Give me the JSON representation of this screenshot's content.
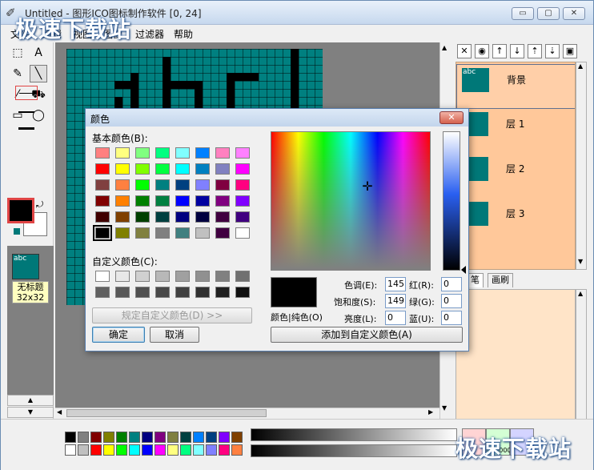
{
  "window": {
    "title": "Untitled - 图形ICO图标制作软件 [0, 24]",
    "watermark": "极速下载站",
    "controls": {
      "minimize": "▭",
      "maximize": "▢",
      "close": "✕"
    }
  },
  "menu": [
    "文件",
    "编辑",
    "视图",
    "图像",
    "过滤器",
    "帮助"
  ],
  "tools": {
    "select": "⬚",
    "text": "A",
    "pencil": "✎",
    "line": "╲",
    "eyedropper": "⁄",
    "fill": "⛟",
    "rect": "▭",
    "ellipse": "◯"
  },
  "thumbnail": {
    "abc": "abc",
    "name": "无标题",
    "size": "32x32"
  },
  "layers": {
    "items": [
      {
        "name": "背景",
        "abc": "abc"
      },
      {
        "name": "层 1",
        "abc": ""
      },
      {
        "name": "层 2",
        "abc": ""
      },
      {
        "name": "层 3",
        "abc": ""
      }
    ],
    "toolbar": [
      "✕",
      "◉",
      "↑",
      "↓",
      "⇡",
      "⇣",
      "▣"
    ],
    "tabs": [
      "笔",
      "画刷"
    ]
  },
  "dialog": {
    "title": "颜色",
    "close": "✕",
    "basic_label": "基本颜色(B):",
    "custom_label": "自定义颜色(C):",
    "define_button": "规定自定义颜色(D) >>",
    "ok_button": "确定",
    "cancel_button": "取消",
    "add_button": "添加到自定义颜色(A)",
    "color_solid_label": "颜色|纯色(O)",
    "fields": {
      "hue_label": "色调(E):",
      "hue": "145",
      "sat_label": "饱和度(S):",
      "sat": "149",
      "lum_label": "亮度(L):",
      "lum": "0",
      "red_label": "红(R):",
      "red": "0",
      "green_label": "绿(G):",
      "green": "0",
      "blue_label": "蓝(U):",
      "blue": "0"
    },
    "basic_colors": [
      [
        "#ff8080",
        "#ffff80",
        "#80ff80",
        "#00ff80",
        "#80ffff",
        "#0080ff",
        "#ff80c0",
        "#ff80ff"
      ],
      [
        "#ff0000",
        "#ffff00",
        "#80ff00",
        "#00ff40",
        "#00ffff",
        "#0080c0",
        "#8080c0",
        "#ff00ff"
      ],
      [
        "#804040",
        "#ff8040",
        "#00ff00",
        "#008080",
        "#004080",
        "#8080ff",
        "#800040",
        "#ff0080"
      ],
      [
        "#800000",
        "#ff8000",
        "#008000",
        "#008040",
        "#0000ff",
        "#0000a0",
        "#800080",
        "#8000ff"
      ],
      [
        "#400000",
        "#804000",
        "#004000",
        "#004040",
        "#000080",
        "#000040",
        "#400040",
        "#400080"
      ],
      [
        "#000000",
        "#808000",
        "#808040",
        "#808080",
        "#408080",
        "#c0c0c0",
        "#400040",
        "#ffffff"
      ]
    ],
    "custom_colors": [
      [
        "#ffffff",
        "#e8e8e8",
        "#d0d0d0",
        "#b8b8b8",
        "#a0a0a0",
        "#909090",
        "#808080",
        "#707070"
      ],
      [
        "#606060",
        "#585858",
        "#505050",
        "#484848",
        "#404040",
        "#303030",
        "#202020",
        "#101010"
      ]
    ]
  },
  "palette": {
    "row1": [
      "#000000",
      "#808080",
      "#800000",
      "#808000",
      "#008000",
      "#008080",
      "#000080",
      "#800080",
      "#808040",
      "#004040",
      "#0080ff",
      "#004080",
      "#8000ff",
      "#804000"
    ],
    "row2": [
      "#ffffff",
      "#c0c0c0",
      "#ff0000",
      "#ffff00",
      "#00ff00",
      "#00ffff",
      "#0000ff",
      "#ff00ff",
      "#ffff80",
      "#00ff80",
      "#80ffff",
      "#8080ff",
      "#ff0080",
      "#ff8040"
    ],
    "hex_label": "000000"
  }
}
